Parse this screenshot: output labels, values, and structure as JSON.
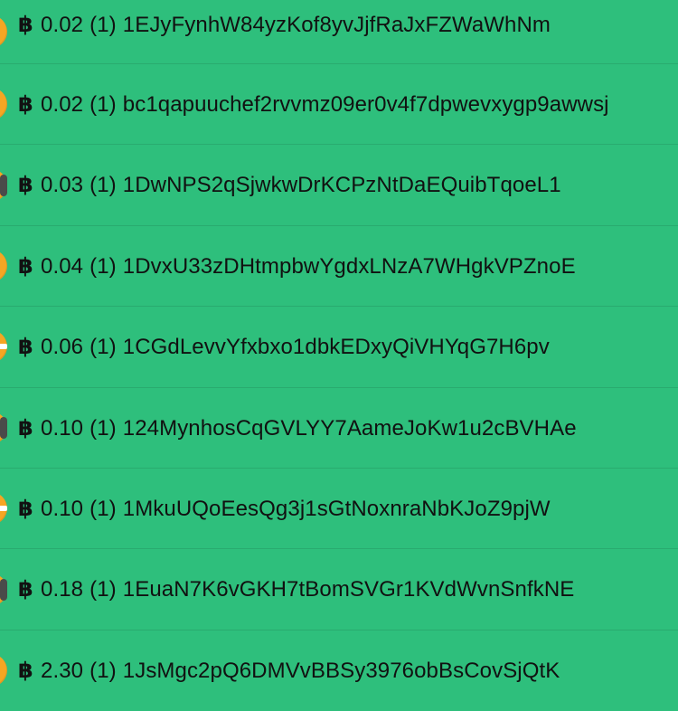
{
  "currency_symbol": "฿",
  "colors": {
    "background": "#2EBF7C",
    "coin": "#F5A623",
    "text": "#111111"
  },
  "transactions": [
    {
      "amount": "0.02",
      "count": "(1)",
      "address": "1EJyFynhW84yzKof8yvJjfRaJxFZWaWhNm",
      "icon": "coin-icon"
    },
    {
      "amount": "0.02",
      "count": "(1)",
      "address": "bc1qapuuchef2rvvmz09er0v4f7dpwevxygp9awwsj",
      "icon": "coin-icon"
    },
    {
      "amount": "0.03",
      "count": "(1)",
      "address": "1DwNPS2qSjwkwDrKCPzNtDaEQuibTqoeL1",
      "icon": "coin-icon"
    },
    {
      "amount": "0.04",
      "count": "(1)",
      "address": "1DvxU33zDHtmpbwYgdxLNzA7WHgkVPZnoE",
      "icon": "coin-icon"
    },
    {
      "amount": "0.06",
      "count": "(1)",
      "address": "1CGdLevvYfxbxo1dbkEDxyQiVHYqG7H6pv",
      "icon": "coin-icon"
    },
    {
      "amount": "0.10",
      "count": "(1)",
      "address": "124MynhosCqGVLYY7AameJoKw1u2cBVHAe",
      "icon": "coin-icon"
    },
    {
      "amount": "0.10",
      "count": "(1)",
      "address": "1MkuUQoEesQg3j1sGtNoxnraNbKJoZ9pjW",
      "icon": "coin-icon"
    },
    {
      "amount": "0.18",
      "count": "(1)",
      "address": "1EuaN7K6vGKH7tBomSVGr1KVdWvnSnfkNE",
      "icon": "coin-icon"
    },
    {
      "amount": "2.30",
      "count": "(1)",
      "address": "1JsMgc2pQ6DMVvBBSy3976obBsCovSjQtK",
      "icon": "coin-icon"
    }
  ]
}
